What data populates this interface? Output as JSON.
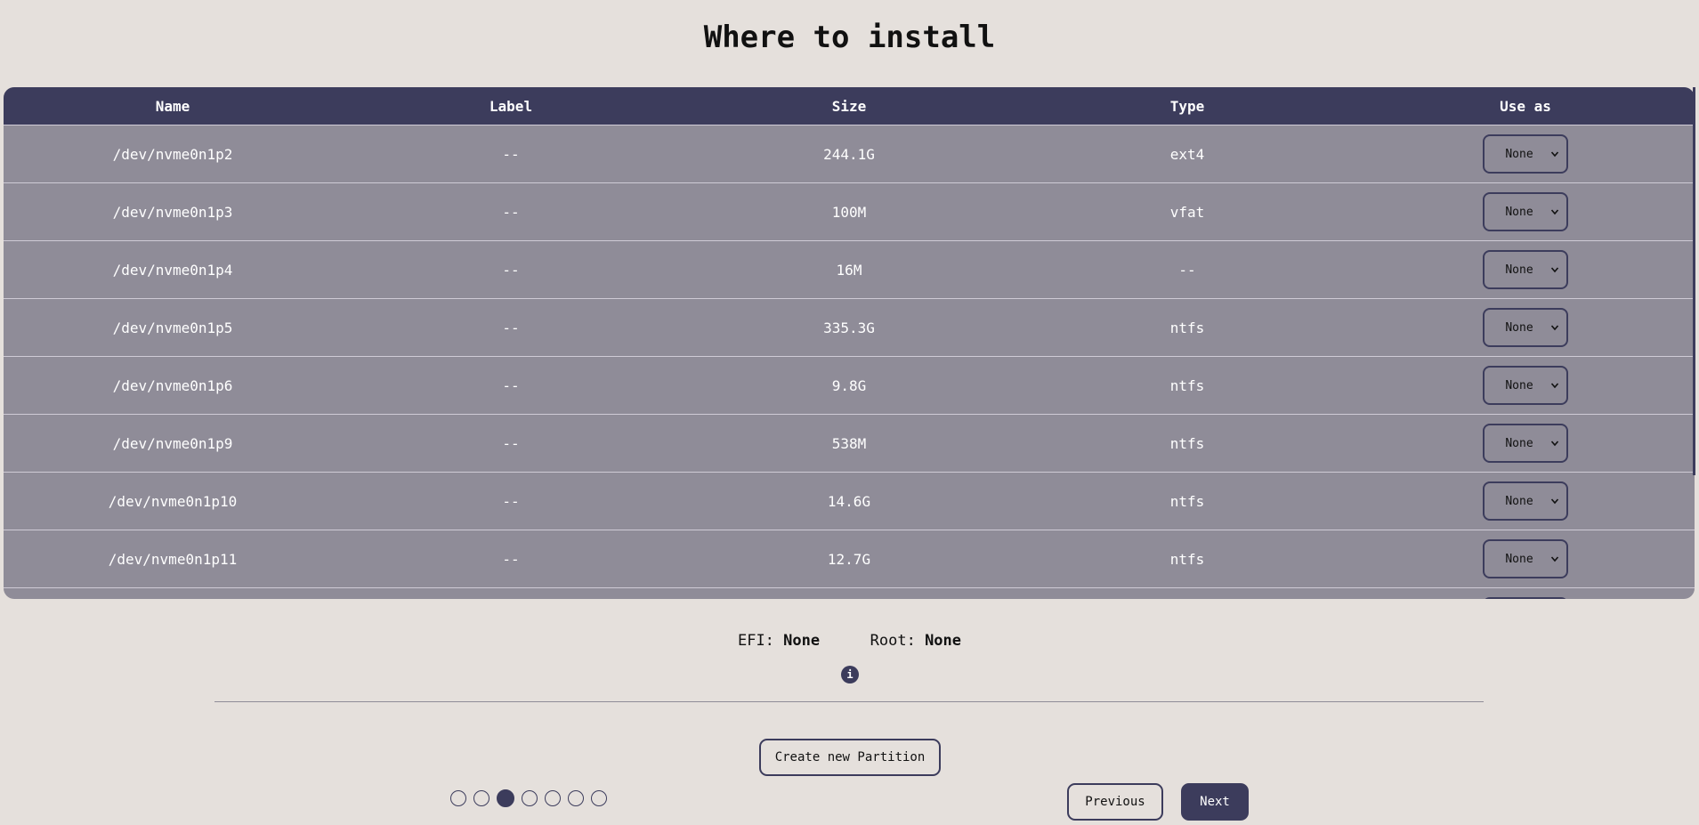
{
  "page": {
    "title": "Where to install"
  },
  "table": {
    "columns": [
      "Name",
      "Label",
      "Size",
      "Type",
      "Use as"
    ],
    "rows": [
      {
        "name": "/dev/nvme0n1p2",
        "label": "--",
        "size": "244.1G",
        "type": "ext4",
        "use_as": "None"
      },
      {
        "name": "/dev/nvme0n1p3",
        "label": "--",
        "size": "100M",
        "type": "vfat",
        "use_as": "None"
      },
      {
        "name": "/dev/nvme0n1p4",
        "label": "--",
        "size": "16M",
        "type": "--",
        "use_as": "None"
      },
      {
        "name": "/dev/nvme0n1p5",
        "label": "--",
        "size": "335.3G",
        "type": "ntfs",
        "use_as": "None"
      },
      {
        "name": "/dev/nvme0n1p6",
        "label": "--",
        "size": "9.8G",
        "type": "ntfs",
        "use_as": "None"
      },
      {
        "name": "/dev/nvme0n1p9",
        "label": "--",
        "size": "538M",
        "type": "ntfs",
        "use_as": "None"
      },
      {
        "name": "/dev/nvme0n1p10",
        "label": "--",
        "size": "14.6G",
        "type": "ntfs",
        "use_as": "None"
      },
      {
        "name": "/dev/nvme0n1p11",
        "label": "--",
        "size": "12.7G",
        "type": "ntfs",
        "use_as": "None"
      }
    ]
  },
  "summary": {
    "efi_label": "EFI:",
    "efi_value": "None",
    "root_label": "Root:",
    "root_value": "None",
    "info_glyph": "i"
  },
  "actions": {
    "create_partition": "Create new Partition",
    "previous": "Previous",
    "next": "Next"
  },
  "stepper": {
    "total_steps": 7,
    "current_step": 3
  },
  "colors": {
    "background": "#e5e0dc",
    "accent": "#3c3c5c",
    "row_background": "#8f8c98"
  }
}
